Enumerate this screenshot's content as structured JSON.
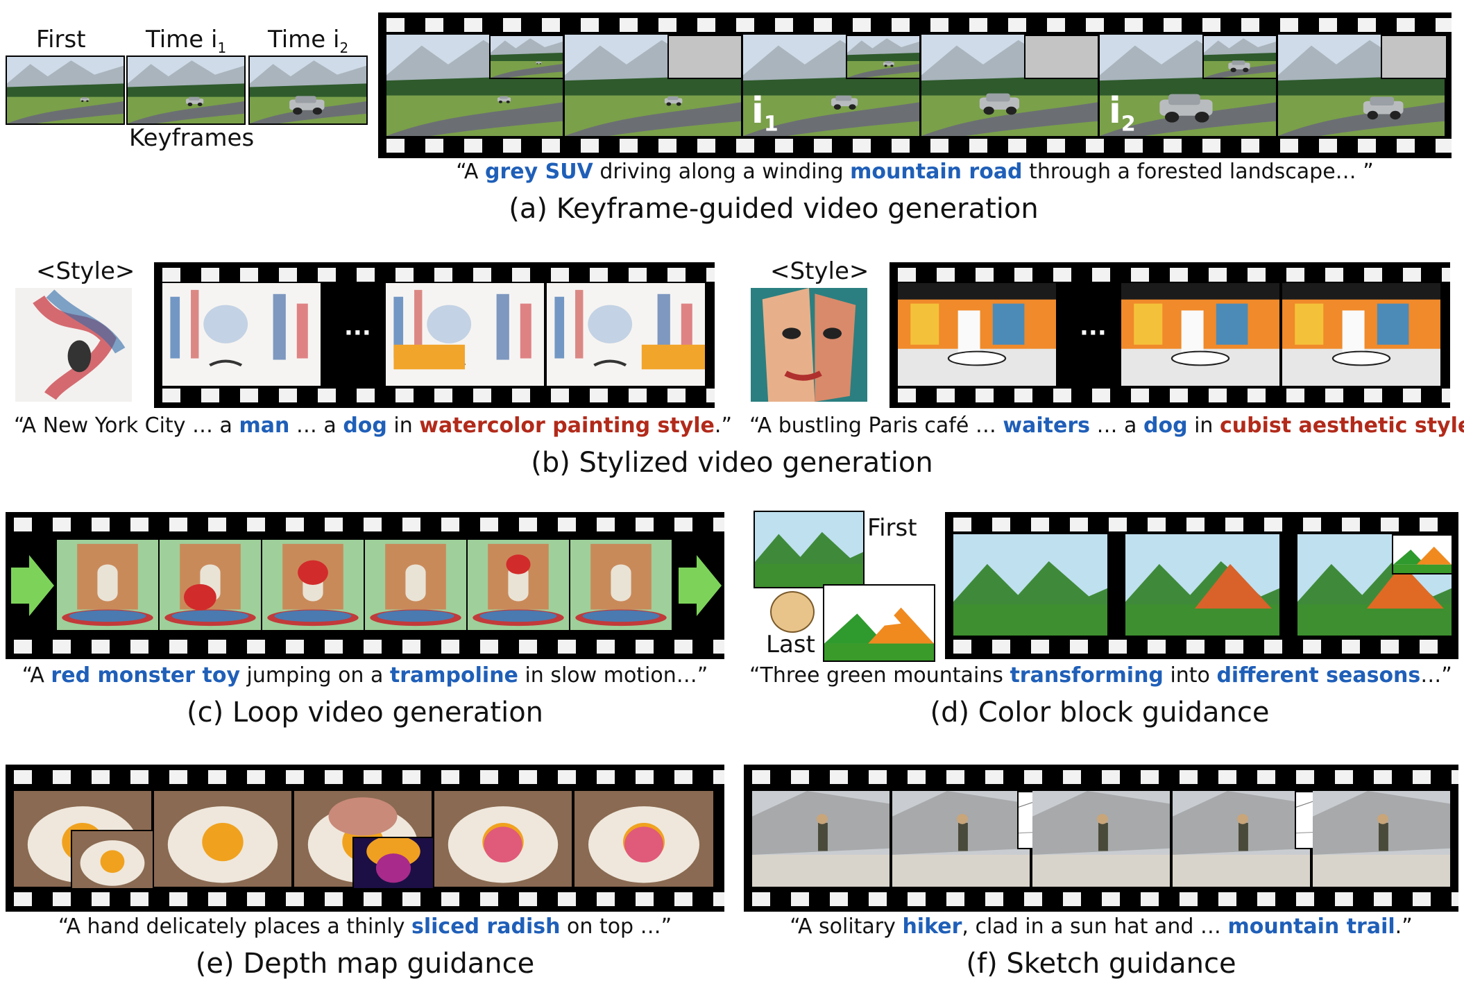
{
  "panel_a": {
    "labels": {
      "first": "First",
      "time_i1": "Time i",
      "time_i1_sub": "1",
      "time_i2": "Time i",
      "time_i2_sub": "2",
      "keyframes": "Keyframes"
    },
    "mark_i1": "i",
    "mark_i1_sub": "1",
    "mark_i2": "i",
    "mark_i2_sub": "2",
    "caption": {
      "q1": "“A ",
      "k1": "grey SUV",
      "t1": " driving along a winding ",
      "k2": "mountain road",
      "t2": " through a forested landscape… ”"
    },
    "title": "(a) Keyframe-guided video generation"
  },
  "panel_b": {
    "style_label_left": "<Style>",
    "style_label_right": "<Style>",
    "ellipsis": "···",
    "caption_left": {
      "t1": "“A New York City … a ",
      "k1": "man",
      "t2": " … a ",
      "k2": "dog",
      "t3": " in ",
      "s1": "watercolor painting style",
      "t4": ".”"
    },
    "caption_right": {
      "t1": "“A bustling Paris café … ",
      "k1": "waiters",
      "t2": " … a ",
      "k2": "dog",
      "t3": " in ",
      "s1": "cubist aesthetic style",
      "t4": ".”"
    },
    "title": "(b) Stylized video generation"
  },
  "panel_c": {
    "caption": {
      "t1": "“A ",
      "k1": "red monster toy",
      "t2": " jumping on a ",
      "k2": "trampoline",
      "t3": " in slow motion…”"
    },
    "title": "(c) Loop video generation"
  },
  "panel_d": {
    "label_first": "First",
    "label_last": "Last",
    "caption": {
      "t1": "“Three green mountains ",
      "k1": "transforming",
      "t2": " into ",
      "k2": "different seasons",
      "t3": "…”"
    },
    "title": "(d) Color block guidance"
  },
  "panel_e": {
    "caption": {
      "t1": "“A hand delicately places a thinly ",
      "k1": "sliced radish",
      "t2": " on top …”"
    },
    "title": "(e) Depth map guidance"
  },
  "panel_f": {
    "caption": {
      "t1": "“A solitary ",
      "k1": "hiker",
      "t2": ", clad in a sun hat and … ",
      "k2": "mountain trail",
      "t3": ".”"
    },
    "title": "(f) Sketch guidance"
  },
  "colors": {
    "keyword_blue": "#1f5fb8",
    "style_red": "#b22a1a",
    "film_black": "#000000",
    "arrow_green": "#7dd35a"
  }
}
